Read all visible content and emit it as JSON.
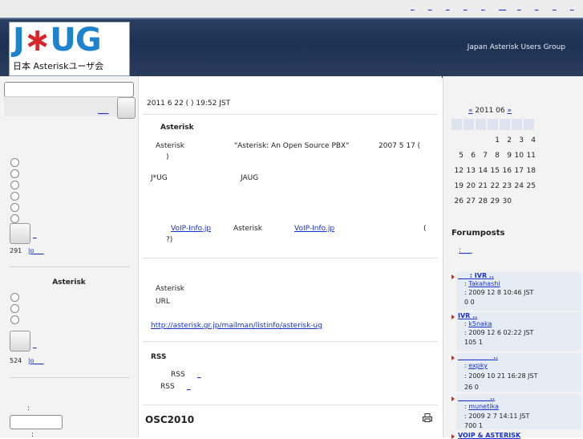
{
  "header": {
    "logo_mark_j": "J",
    "logo_mark_star": "∗",
    "logo_mark_ug": "UG",
    "logo_subtitle": "日本 Asteriskユーザ会",
    "site_name": "Japan Asterisk Users Group",
    "top_nav": [
      "_",
      "_",
      "_",
      "_",
      "_",
      "__",
      "_",
      "_",
      "_",
      "_"
    ]
  },
  "left": {
    "search_link": "___",
    "poll1": {
      "vote_link": "_",
      "count": "291",
      "count_link": "|o___"
    },
    "poll2": {
      "title": "Asterisk",
      "vote_link": "_",
      "count": "524",
      "count_link": "|o___"
    },
    "login": {
      "label1": ":",
      "label2": ":"
    }
  },
  "main": {
    "date": "2011 6 22 ( ) 19:52 JST",
    "section1_title": "Asterisk",
    "s1_a": "Asterisk",
    "s1_b": "\"Asterisk: An Open Source PBX\"",
    "s1_c": "2007 5 17 (",
    "s1_d": ")",
    "s1_e": "J*UG",
    "s1_f": "JAUG",
    "voip_link1": "VoIP-Info.jp",
    "voip_mid": "Asterisk",
    "voip_link2": "VoIP-Info.jp",
    "voip_paren": "(",
    "voip_q": "?)",
    "ml_a": "Asterisk",
    "ml_b": "URL",
    "ml_url": "http://asterisk.gr.jp/mailman/listinfo/asterisk-ug",
    "rss_title": "RSS",
    "rss_1": "RSS",
    "rss_1_link": "_",
    "rss_2": "RSS",
    "rss_2_link": "_",
    "osc_title": "OSC2010"
  },
  "right": {
    "cal_prev": "«",
    "cal_month": "2011 06",
    "cal_next": "»",
    "cal_rows": [
      [
        "",
        "",
        "",
        "1",
        "2",
        "3",
        "4"
      ],
      [
        "5",
        "6",
        "7",
        "8",
        "9",
        "10",
        "11"
      ],
      [
        "12",
        "13",
        "14",
        "15",
        "16",
        "17",
        "18"
      ],
      [
        "19",
        "20",
        "21",
        "22",
        "23",
        "24",
        "25"
      ],
      [
        "26",
        "27",
        "28",
        "29",
        "30",
        "",
        ""
      ]
    ],
    "forum_title": "Forumposts",
    "forum_more": ":___",
    "posts": [
      {
        "title": "___ :        IVR    ..",
        "author": "Takahashi",
        "date": ": 2009 12 8  10:46 JST",
        "stats": "0       0"
      },
      {
        "title": "             IVR       ..",
        "author": "k5naka",
        "date": ": 2009 12 6  02:22 JST",
        "stats": "105        1"
      },
      {
        "title": "___________..",
        "author": "expky",
        "date": ": 2009 10 21  16:28 JST",
        "stats": "26        0"
      },
      {
        "title": "__________..",
        "author": "munetika",
        "date": ": 2009 2 7  14:11 JST",
        "stats": "700        1"
      },
      {
        "title": "VOIP & ASTERISK",
        "author": "",
        "date": "",
        "stats": ""
      }
    ]
  }
}
